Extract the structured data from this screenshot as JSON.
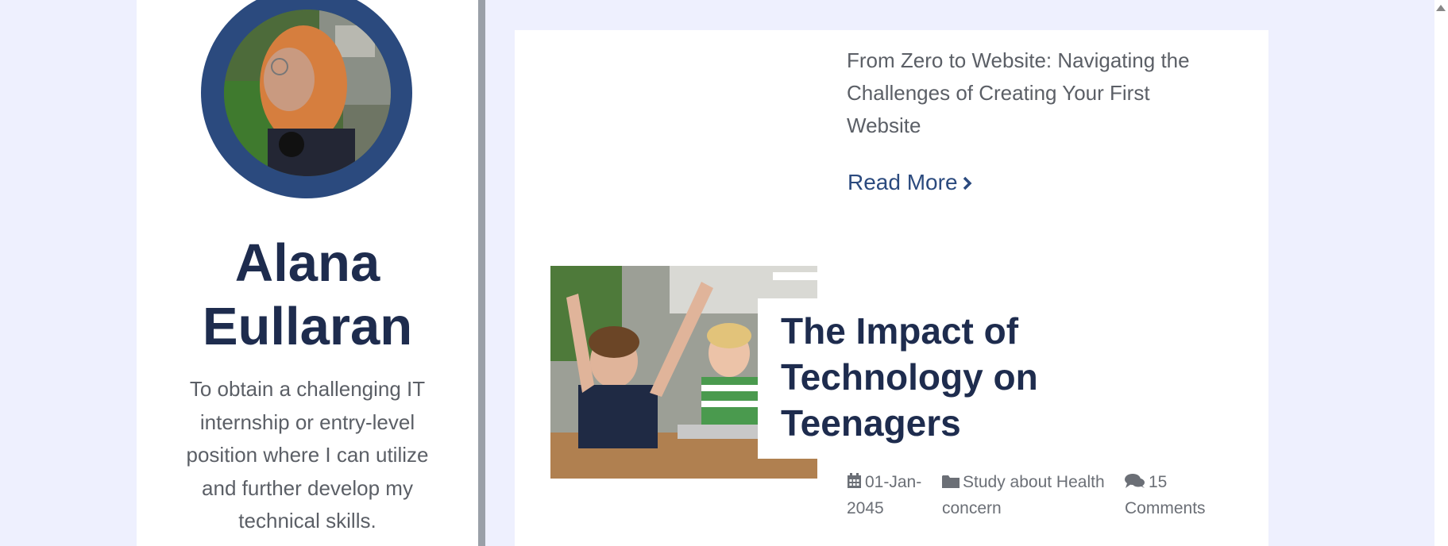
{
  "profile": {
    "name_line1": "Alana",
    "name_line2": "Eullaran",
    "objective": "To obtain a challenging IT internship or entry-level position where I can utilize and further develop my technical skills."
  },
  "posts": [
    {
      "title": "From Zero to Website: Navigating the Challenges of Creating Your First Website",
      "read_more": "Read More"
    },
    {
      "title": "The Impact of Technology on Teenagers",
      "date": "01-Jan-2045",
      "category": "Study about Health concern",
      "comments": "15 Comments"
    }
  ],
  "icons": {
    "chevron": "chevron-right-icon",
    "calendar": "calendar-icon",
    "folder": "folder-icon",
    "comments": "comments-icon"
  },
  "colors": {
    "page_bg": "#eef0fe",
    "accent_navy": "#2b4a7e",
    "heading": "#1e2c4e",
    "body_text": "#5b5f66"
  }
}
